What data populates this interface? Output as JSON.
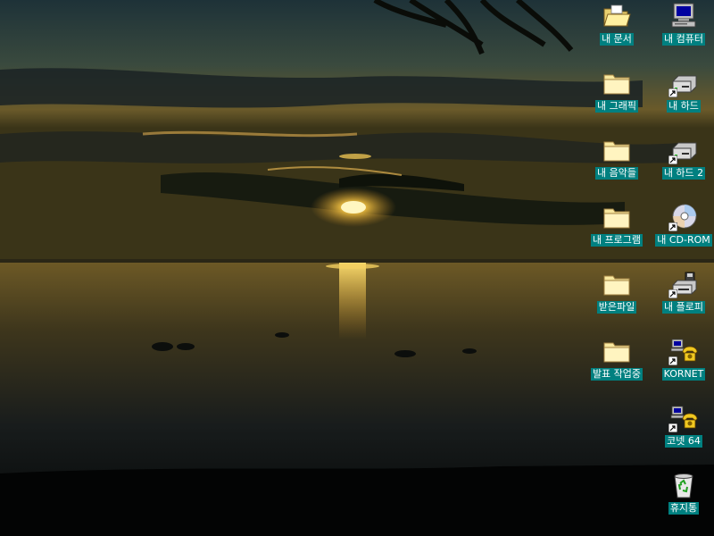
{
  "desktop": {
    "wallpaper_icon": "sunset-over-water-wallpaper",
    "label_background": "#008080",
    "label_color": "#ffffff",
    "icons_left_column": [
      {
        "label": "내 문서",
        "icon": "open-folder-icon"
      },
      {
        "label": "내 그래픽",
        "icon": "folder-icon"
      },
      {
        "label": "내 음악들",
        "icon": "folder-icon"
      },
      {
        "label": "내 프로그램",
        "icon": "folder-icon"
      },
      {
        "label": "받은파일",
        "icon": "folder-icon"
      },
      {
        "label": "발표 작업중",
        "icon": "folder-icon"
      }
    ],
    "icons_right_column": [
      {
        "label": "내 컴퓨터",
        "icon": "computer-icon"
      },
      {
        "label": "내 하드",
        "icon": "hard-drive-icon"
      },
      {
        "label": "내 하드 2",
        "icon": "hard-drive-icon"
      },
      {
        "label": "내 CD-ROM",
        "icon": "cd-rom-icon"
      },
      {
        "label": "내 플로피",
        "icon": "floppy-drive-icon"
      },
      {
        "label": "KORNET",
        "icon": "network-phone-icon"
      },
      {
        "label": "코넷 64",
        "icon": "network-phone-icon"
      },
      {
        "label": "휴지통",
        "icon": "recycle-bin-icon"
      }
    ]
  }
}
